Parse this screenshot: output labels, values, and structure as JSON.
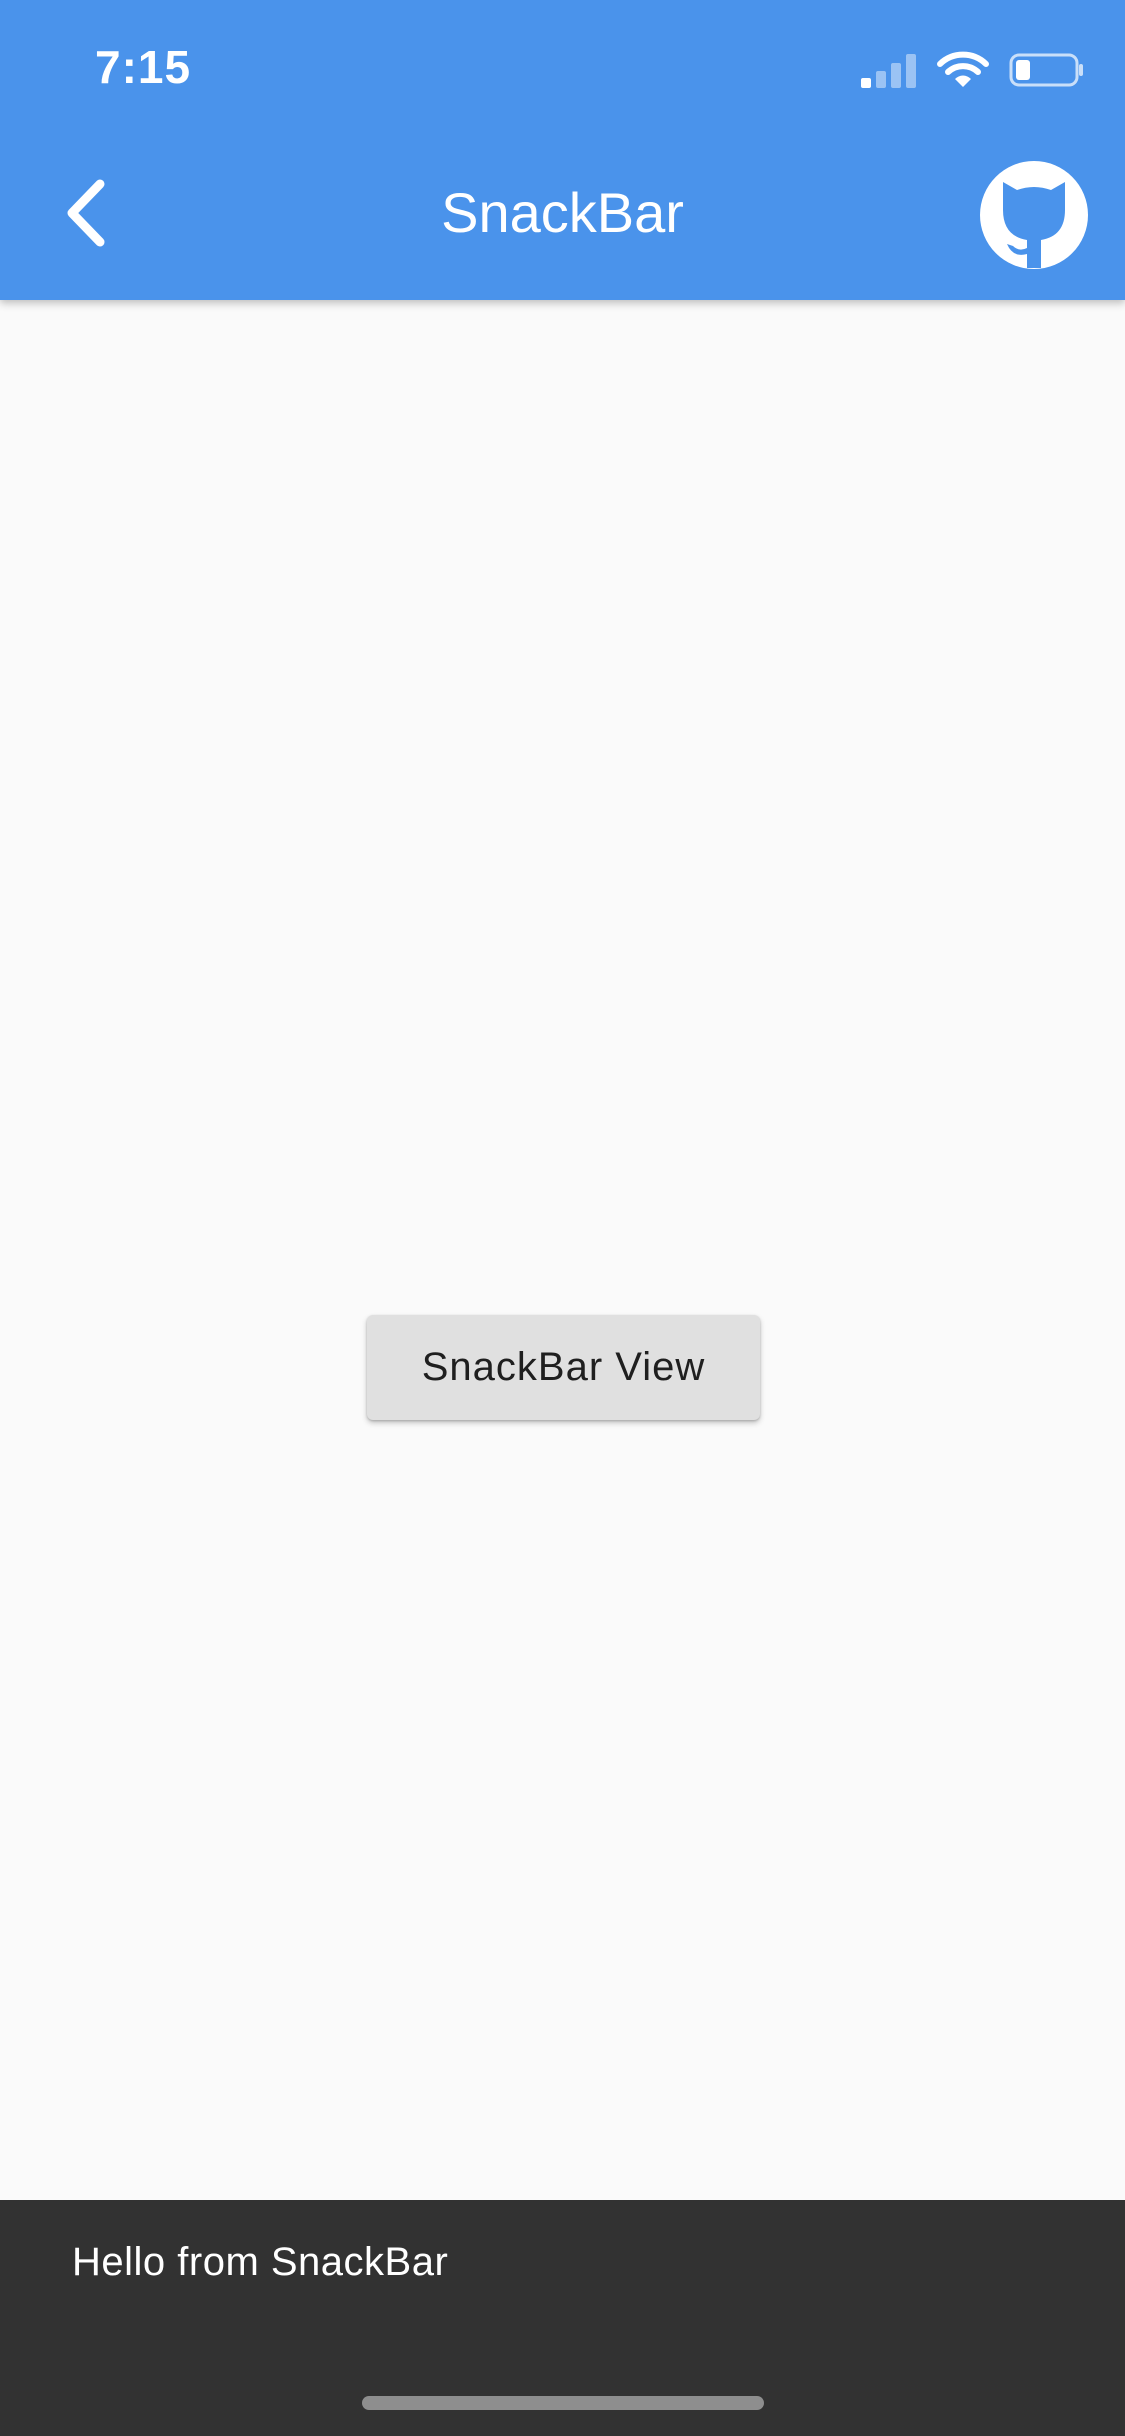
{
  "status_bar": {
    "time": "7:15",
    "icons": [
      "cellular-signal-icon",
      "wifi-icon",
      "battery-icon"
    ]
  },
  "app_bar": {
    "title": "SnackBar",
    "back_icon": "chevron-left-icon",
    "action_icon": "github-icon",
    "background_color": "#4a93eb"
  },
  "main": {
    "button_label": "SnackBar View"
  },
  "snackbar": {
    "message": "Hello from SnackBar",
    "background_color": "#323232"
  }
}
